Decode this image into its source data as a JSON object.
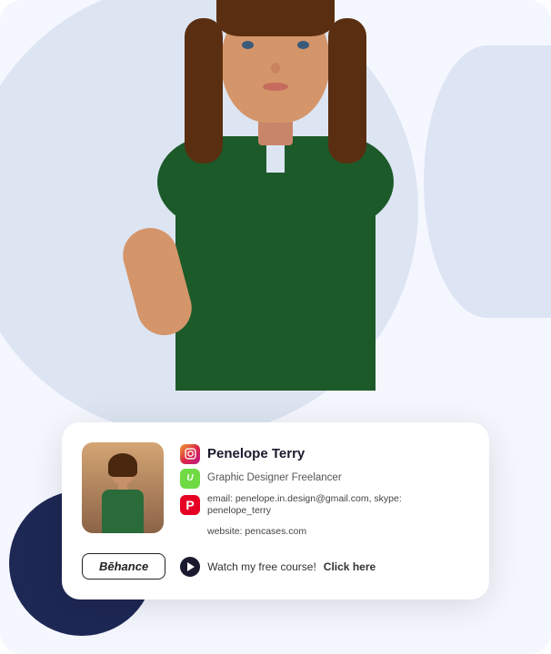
{
  "person": {
    "name": "Penelope Terry",
    "title": "Graphic Designer Freelancer",
    "email": "penelope.in.design@gmail.com",
    "skype": "penelope_terry",
    "website": "pencases.com",
    "email_label": "email:",
    "skype_label": "skype:",
    "website_label": "website:"
  },
  "card": {
    "contact_line1": "email:  penelope.in.design@gmail.com, skype:  penelope_terry",
    "contact_line2": "website: pencases.com",
    "behance_label": "Bēhance",
    "course_text": "Watch my free course!",
    "course_cta": "Click here"
  },
  "icons": {
    "instagram": "IG",
    "upwork": "Up",
    "pinterest": "P"
  }
}
